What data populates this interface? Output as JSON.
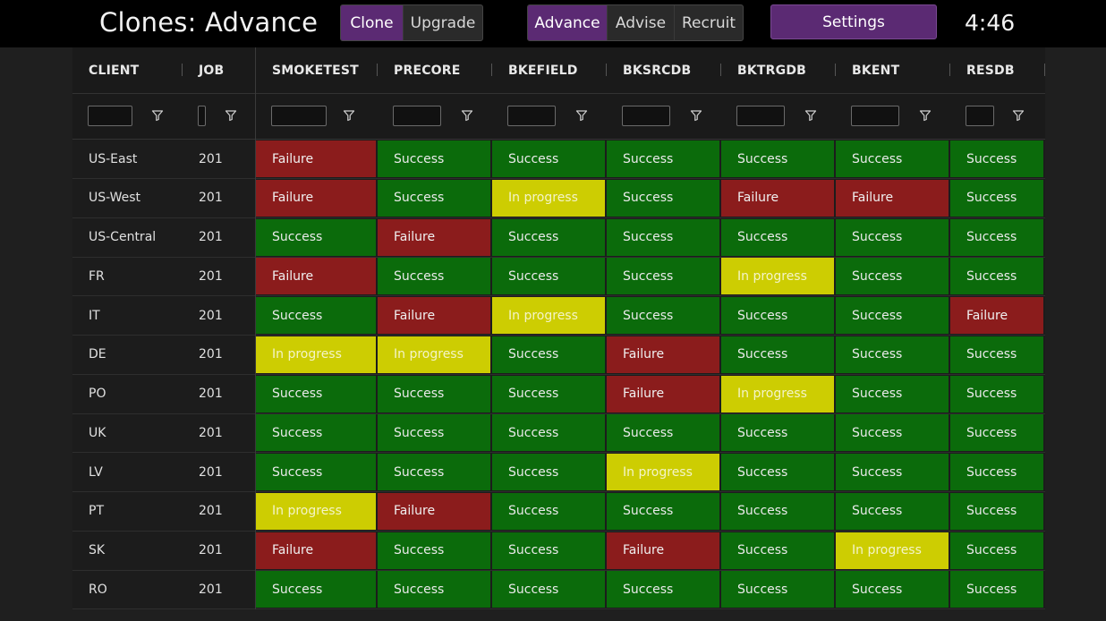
{
  "app": {
    "title": "Clones: Advance",
    "clock": "4:46"
  },
  "nav": {
    "group1": [
      {
        "label": "Clone",
        "active": true
      },
      {
        "label": "Upgrade",
        "active": false
      }
    ],
    "group2": [
      {
        "label": "Advance",
        "active": true
      },
      {
        "label": "Advise",
        "active": false
      },
      {
        "label": "Recruit",
        "active": false
      }
    ],
    "settings_label": "Settings"
  },
  "colors": {
    "success": "#0b6b0b",
    "failure": "#8b1c1c",
    "in_progress": "#cdcd02",
    "accent": "#5b2a73"
  },
  "table": {
    "columns": [
      "CLIENT",
      "JOB",
      "SMOKETEST",
      "PRECORE",
      "BKEFIELD",
      "BKSRCDB",
      "BKTRGDB",
      "BKENT",
      "RESDB"
    ],
    "filter_icon": "filter-icon",
    "rows": [
      {
        "client": "US-East",
        "job": "201",
        "statuses": [
          "Failure",
          "Success",
          "Success",
          "Success",
          "Success",
          "Success",
          "Success"
        ]
      },
      {
        "client": "US-West",
        "job": "201",
        "statuses": [
          "Failure",
          "Success",
          "In progress",
          "Success",
          "Failure",
          "Failure",
          "Success"
        ]
      },
      {
        "client": "US-Central",
        "job": "201",
        "statuses": [
          "Success",
          "Failure",
          "Success",
          "Success",
          "Success",
          "Success",
          "Success"
        ]
      },
      {
        "client": "FR",
        "job": "201",
        "statuses": [
          "Failure",
          "Success",
          "Success",
          "Success",
          "In progress",
          "Success",
          "Success"
        ]
      },
      {
        "client": "IT",
        "job": "201",
        "statuses": [
          "Success",
          "Failure",
          "In progress",
          "Success",
          "Success",
          "Success",
          "Failure"
        ]
      },
      {
        "client": "DE",
        "job": "201",
        "statuses": [
          "In progress",
          "In progress",
          "Success",
          "Failure",
          "Success",
          "Success",
          "Success"
        ]
      },
      {
        "client": "PO",
        "job": "201",
        "statuses": [
          "Success",
          "Success",
          "Success",
          "Failure",
          "In progress",
          "Success",
          "Success"
        ]
      },
      {
        "client": "UK",
        "job": "201",
        "statuses": [
          "Success",
          "Success",
          "Success",
          "Success",
          "Success",
          "Success",
          "Success"
        ]
      },
      {
        "client": "LV",
        "job": "201",
        "statuses": [
          "Success",
          "Success",
          "Success",
          "In progress",
          "Success",
          "Success",
          "Success"
        ]
      },
      {
        "client": "PT",
        "job": "201",
        "statuses": [
          "In progress",
          "Failure",
          "Success",
          "Success",
          "Success",
          "Success",
          "Success"
        ]
      },
      {
        "client": "SK",
        "job": "201",
        "statuses": [
          "Failure",
          "Success",
          "Success",
          "Failure",
          "Success",
          "In progress",
          "Success"
        ]
      },
      {
        "client": "RO",
        "job": "201",
        "statuses": [
          "Success",
          "Success",
          "Success",
          "Success",
          "Success",
          "Success",
          "Success"
        ]
      }
    ]
  }
}
